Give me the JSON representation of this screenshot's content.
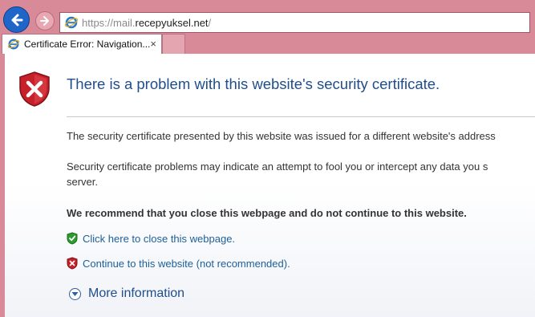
{
  "browser": {
    "address": {
      "protocol": "https://",
      "domain_prefix": "mail.",
      "domain": "recepyuksel.net",
      "path": "/"
    },
    "tab": {
      "title": "Certificate Error: Navigation...",
      "close_label": "×"
    },
    "icons": {
      "back": "back-arrow-icon",
      "forward": "forward-arrow-icon",
      "browser": "internet-explorer-icon"
    }
  },
  "page": {
    "title": "There is a problem with this website's security certificate.",
    "paragraph_1": "The security certificate presented by this website was issued for a different website's address",
    "paragraph_2_line_1": "Security certificate problems may indicate an attempt to fool you or intercept any data you s",
    "paragraph_2_line_2": "server.",
    "recommendation": "We recommend that you close this webpage and do not continue to this website.",
    "actions": {
      "close": "Click here to close this webpage.",
      "continue": "Continue to this website (not recommended)."
    },
    "more_information": "More information"
  },
  "colors": {
    "chrome": "#d98a98",
    "title": "#1f4e8c",
    "link": "#1c5f9a",
    "shield_red": "#c8202a",
    "shield_green": "#2e9b2e"
  }
}
